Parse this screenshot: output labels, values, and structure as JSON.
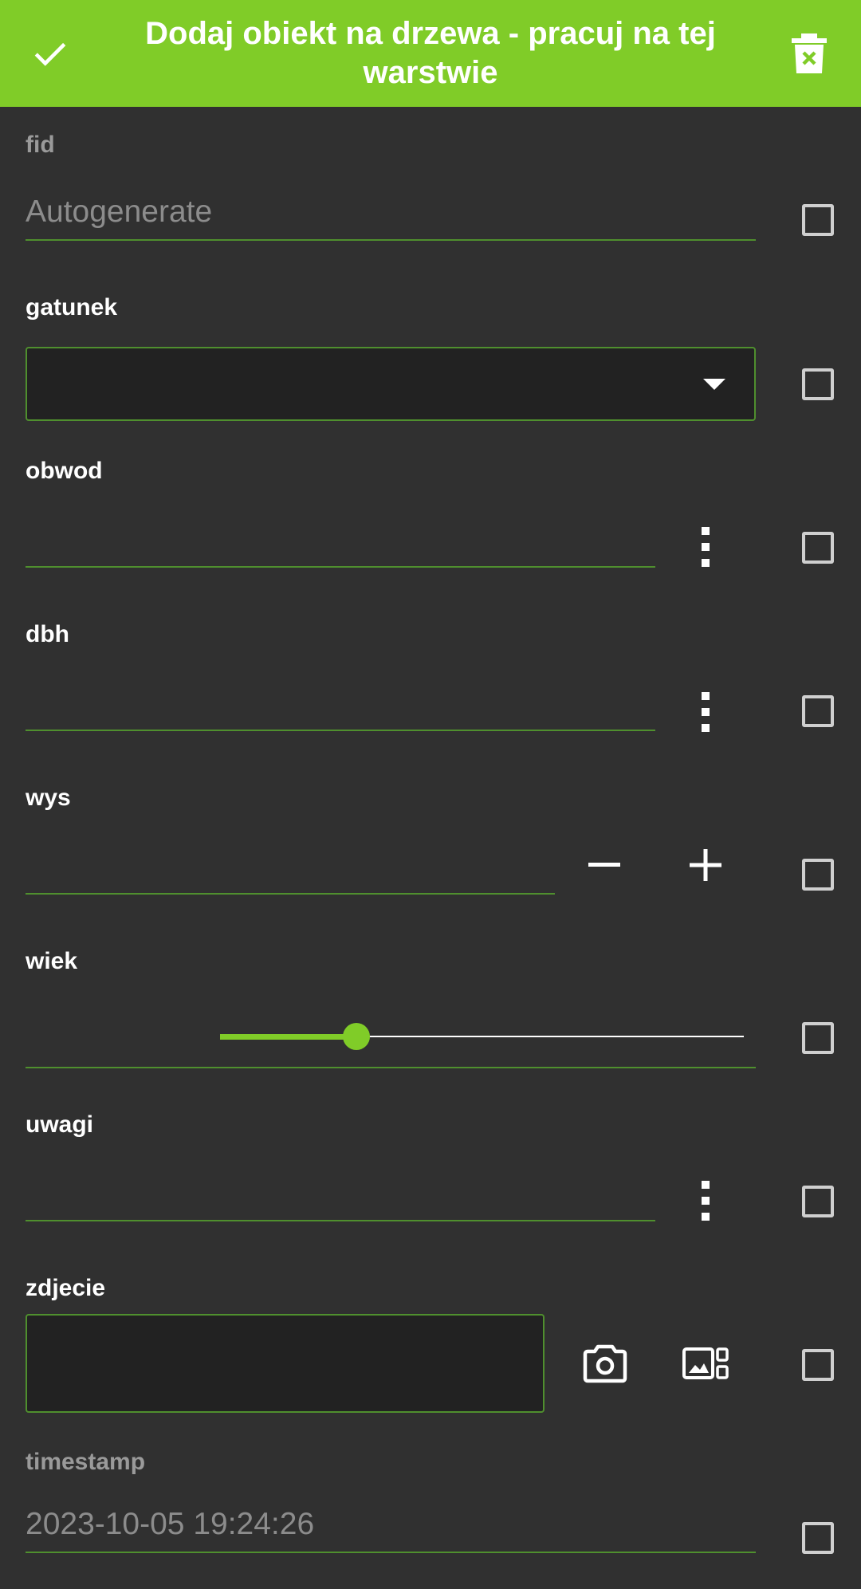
{
  "header": {
    "title": "Dodaj obiekt na drzewa - pracuj na tej warstwie",
    "accent_color": "#80cc28",
    "confirm_icon": "check-icon",
    "delete_icon": "trash-icon"
  },
  "fields": {
    "fid": {
      "label": "fid",
      "placeholder": "Autogenerate"
    },
    "gatunek": {
      "label": "gatunek",
      "value": ""
    },
    "obwod": {
      "label": "obwod",
      "value": ""
    },
    "dbh": {
      "label": "dbh",
      "value": ""
    },
    "wys": {
      "label": "wys",
      "value": ""
    },
    "wiek": {
      "label": "wiek",
      "slider_fraction": 0.26
    },
    "uwagi": {
      "label": "uwagi",
      "value": ""
    },
    "zdjecie": {
      "label": "zdjecie"
    },
    "timestamp": {
      "label": "timestamp",
      "value": "2023-10-05 19:24:26"
    }
  }
}
